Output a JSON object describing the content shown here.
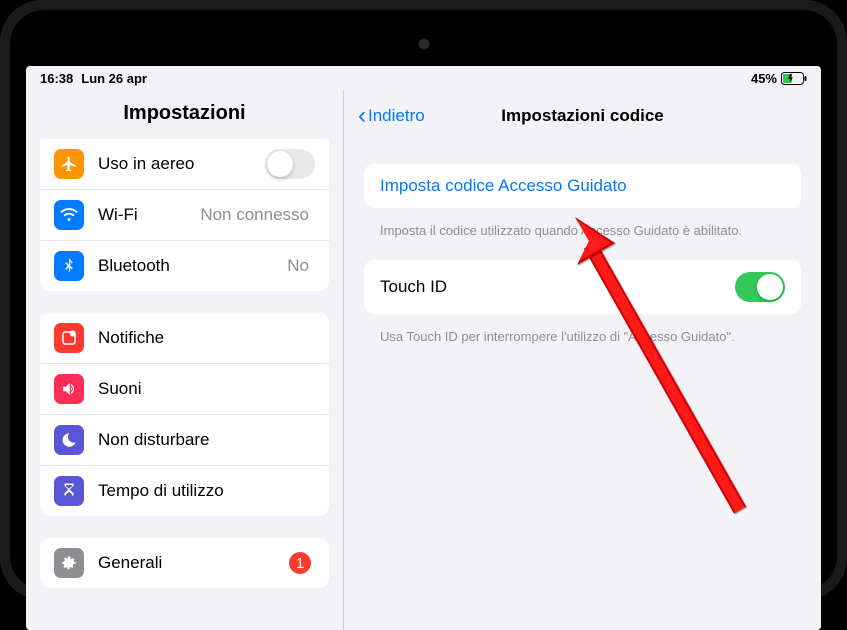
{
  "status": {
    "time": "16:38",
    "date": "Lun 26 apr",
    "battery_pct": "45%"
  },
  "sidebar": {
    "title": "Impostazioni",
    "airplane": {
      "label": "Uso in aereo",
      "on": false
    },
    "wifi": {
      "label": "Wi-Fi",
      "detail": "Non connesso"
    },
    "bluetooth": {
      "label": "Bluetooth",
      "detail": "No"
    },
    "notifications": {
      "label": "Notifiche"
    },
    "sounds": {
      "label": "Suoni"
    },
    "dnd": {
      "label": "Non disturbare"
    },
    "screentime": {
      "label": "Tempo di utilizzo"
    },
    "general": {
      "label": "Generali",
      "badge": "1"
    }
  },
  "detail": {
    "back_label": "Indietro",
    "title": "Impostazioni codice",
    "set_passcode": "Imposta codice Accesso Guidato",
    "set_passcode_footer": "Imposta il codice utilizzato quando Accesso Guidato è abilitato.",
    "touch_id_label": "Touch ID",
    "touch_id_on": true,
    "touch_id_footer": "Usa Touch ID per interrompere l'utilizzo di \"Accesso Guidato\"."
  },
  "colors": {
    "orange": "#ff9500",
    "blue": "#007aff",
    "red": "#ff3b30",
    "pink": "#ff2d55",
    "purple": "#5856d6",
    "gray": "#8e8e93",
    "green": "#34c759"
  }
}
